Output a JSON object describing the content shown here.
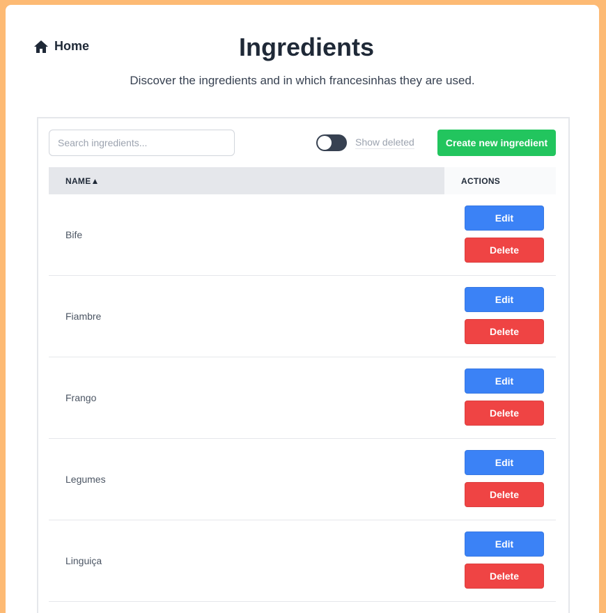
{
  "nav": {
    "home_label": "Home",
    "home_icon": "home-icon"
  },
  "header": {
    "title": "Ingredients",
    "subtitle": "Discover the ingredients and in which francesinhas they are used."
  },
  "toolbar": {
    "search_placeholder": "Search ingredients...",
    "search_value": "",
    "show_deleted_label": "Show deleted",
    "show_deleted_on": false,
    "create_label": "Create new ingredient"
  },
  "table": {
    "columns": {
      "name": "NAME",
      "sort_indicator": "▲",
      "actions": "ACTIONS"
    },
    "rows": [
      {
        "name": "Bife",
        "edit": "Edit",
        "delete": "Delete"
      },
      {
        "name": "Fiambre",
        "edit": "Edit",
        "delete": "Delete"
      },
      {
        "name": "Frango",
        "edit": "Edit",
        "delete": "Delete"
      },
      {
        "name": "Legumes",
        "edit": "Edit",
        "delete": "Delete"
      },
      {
        "name": "Linguiça",
        "edit": "Edit",
        "delete": "Delete"
      }
    ]
  },
  "colors": {
    "background": "#fdba74",
    "create": "#22c55e",
    "edit": "#3b82f6",
    "delete": "#ef4444",
    "toggle": "#374151"
  }
}
